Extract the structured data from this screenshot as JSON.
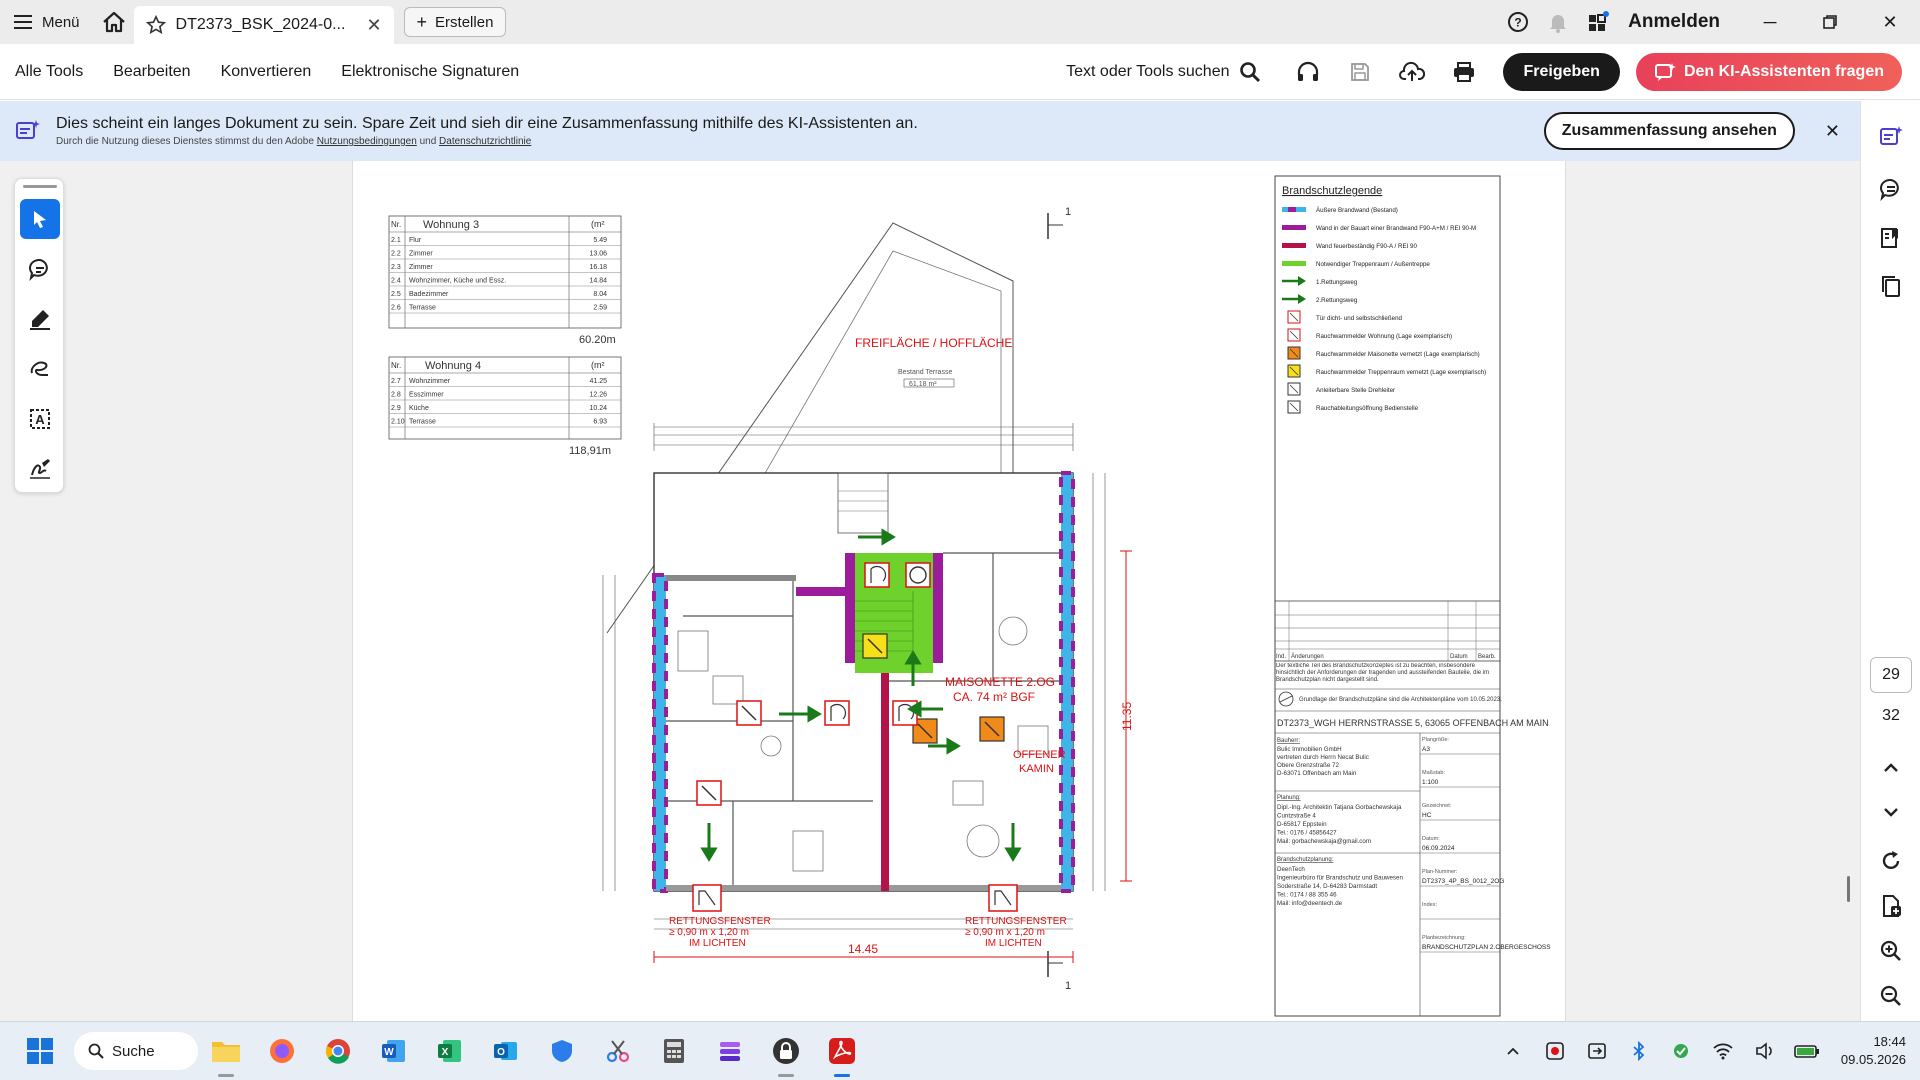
{
  "titlebar": {
    "menu_label": "Menü",
    "tab_title": "DT2373_BSK_2024-0...",
    "create_label": "Erstellen",
    "signin_label": "Anmelden"
  },
  "toolbar": {
    "menu": [
      "Alle Tools",
      "Bearbeiten",
      "Konvertieren",
      "Elektronische Signaturen"
    ],
    "search_label": "Text oder Tools suchen",
    "share_label": "Freigeben",
    "ai_label": "Den KI-Assistenten fragen"
  },
  "banner": {
    "message": "Dies scheint ein langes Dokument zu sein. Spare Zeit und sieh dir eine Zusammenfassung mithilfe des KI-Assistenten an.",
    "sub_prefix": "Durch die Nutzung dieses Dienstes stimmst du den Adobe",
    "terms_link": "Nutzungsbedingungen",
    "sub_and": "und",
    "privacy_link": "Datenschutzrichtlinie",
    "summary_button": "Zusammenfassung ansehen"
  },
  "right_rail": {
    "current_page": "29",
    "total_pages": "32"
  },
  "document": {
    "apt3": {
      "header": [
        "Nr.",
        "Wohnung  3",
        "(m²"
      ],
      "rows": [
        [
          "2.1",
          "Flur",
          "5.49"
        ],
        [
          "2.2",
          "Zimmer",
          "13.06"
        ],
        [
          "2.3",
          "Zimmer",
          "16.18"
        ],
        [
          "2.4",
          "Wohnzimmer, Küche und Essz.",
          "14.84"
        ],
        [
          "2.5",
          "Badezimmer",
          "8.04"
        ],
        [
          "2.6",
          "Terrasse",
          "2.59"
        ]
      ],
      "total": "60.20m"
    },
    "apt4": {
      "header": [
        "Nr.",
        "Wohnung  4",
        "(m²"
      ],
      "rows": [
        [
          "2.7",
          "Wohnzimmer",
          "41.25"
        ],
        [
          "2.8",
          "Esszimmer",
          "12.26"
        ],
        [
          "2.9",
          "Küche",
          "10.24"
        ],
        [
          "2.10",
          "Terrasse",
          "6.93"
        ]
      ],
      "total": "118,91m"
    },
    "plan_labels": {
      "freiflaeche": "FREIFLÄCHE / HOFFLÄCHE",
      "bestand_terrasse": "Bestand Terrasse",
      "terrasse_area": "61,18 m²",
      "maisonette": "MAISONETTE 2.OG",
      "maisonette_area": "CA. 74 m² BGF",
      "offener_kamin_1": "OFFENER",
      "offener_kamin_2": "KAMIN",
      "rettung_1": "RETTUNGSFENSTER",
      "rettung_2": "≥ 0,90 m x 1,20 m",
      "rettung_3": "IM LICHTEN",
      "width_dim": "14.45",
      "height_dim": "11.35",
      "section_mark": "1"
    },
    "legend": {
      "title": "Brandschutzlegende",
      "items": [
        {
          "label": "Äußere Brandwand (Bestand)",
          "color": "#3fb4e8"
        },
        {
          "label": "Wand in der Bauart einer Brandwand F90-A+M / REI 90-M",
          "color": "#9b1d9b"
        },
        {
          "label": "Wand feuerbeständig F90-A / REI 90",
          "color": "#b3124a"
        },
        {
          "label": "Notwendiger Treppenraum / Außentreppe",
          "color": "#6fd12c"
        },
        {
          "label": "1.Rettungsweg",
          "color": "#1a7a1a"
        },
        {
          "label": "2.Rettungsweg",
          "color": "#1a7a1a"
        },
        {
          "label": "Tür dicht- und selbstschließend",
          "color": "#d11"
        },
        {
          "label": "Rauchwarnmelder Wohnung (Lage exemplarisch)",
          "color": "#d11"
        },
        {
          "label": "Rauchwarnmelder Maisonette vernetzt (Lage exemplarisch)",
          "color": "#f08a1a"
        },
        {
          "label": "Rauchwarnmelder Treppenraum vernetzt (Lage exemplarisch)",
          "color": "#f5e01a"
        },
        {
          "label": "Anleiterbare Stelle Drehleiter",
          "color": "#333"
        },
        {
          "label": "Rauchableitungsöffnung Bedienstelle",
          "color": "#333"
        }
      ],
      "rev_headers": [
        "Ind.",
        "Änderungen",
        "Datum",
        "Bearb."
      ],
      "note": "Der textliche Teil des Brandschutzkonzeptes ist zu beachten, insbesondere hinsichtlich der Anforderungen der tragenden und aussteifenden Bauteile, die im Brandschutzplan nicht dargestellt sind.",
      "basis": "Grundlage der Brandschutzpläne sind die Architektenpläne vom 10.05.2023.",
      "project": "DT2373_WGH HERRNSTRASSE 5, 63065 OFFENBACH AM MAIN",
      "bauherr_label": "Bauherr:",
      "bauherr": [
        "Bulic Immobilien GmbH",
        "vertreten durch Herrn Necat Bulic",
        "Obere Grenzstraße 72",
        "D-63071 Offenbach am Main"
      ],
      "planung_label": "Planung:",
      "planung": [
        "Dipl.-Ing. Architektin Tatjana Gorbachewskaja",
        "Cuntzstraße 4",
        "D-65817 Eppstein",
        "Tel.: 0176 / 45856427",
        "Mail: gorbachewskaja@gmail.com"
      ],
      "bsp_label": "Brandschutzplanung:",
      "bsp": [
        "DeenTech",
        "Ingenieurbüro für Brandschutz und Bauwesen",
        "Soderstraße 14, D-64283 Darmstadt",
        "Tel.: 0174 / 88 355 46",
        "Mail: info@deentech.de"
      ],
      "fields": [
        {
          "label": "Plangröße:",
          "value": "A3"
        },
        {
          "label": "Maßstab:",
          "value": "1:100"
        },
        {
          "label": "Gezeichnet:",
          "value": "HC"
        },
        {
          "label": "Datum:",
          "value": "06.09.2024"
        },
        {
          "label": "Plan-Nummer:",
          "value": "DT2373_4P_BS_0012_2OG"
        },
        {
          "label": "Index:",
          "value": ""
        },
        {
          "label": "Planbezeichnung:",
          "value": "BRANDSCHUTZPLAN 2.OBERGESCHOSS"
        }
      ]
    }
  },
  "taskbar": {
    "search_label": "Suche",
    "time": "18:44",
    "date": "09.05.2026"
  }
}
